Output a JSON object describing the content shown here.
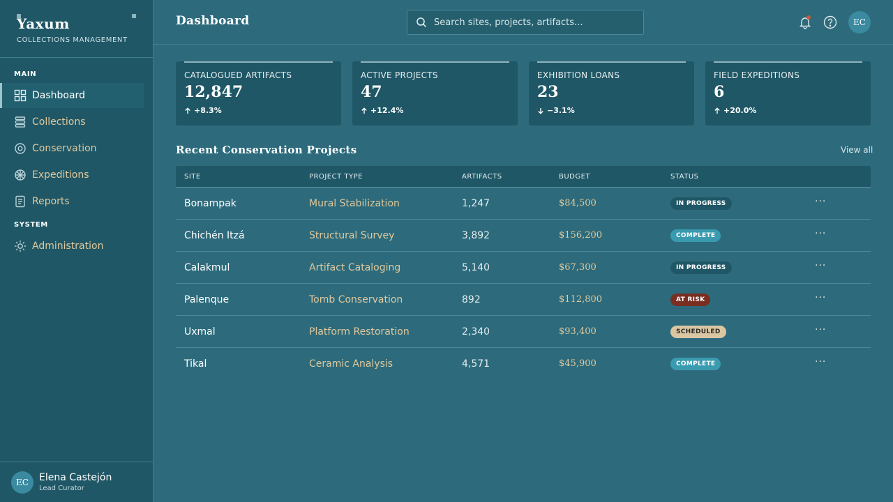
{
  "brand": {
    "name": "Yaxum",
    "subtitle": "COLLECTIONS MANAGEMENT"
  },
  "nav": {
    "main_label": "MAIN",
    "system_label": "SYSTEM",
    "items": [
      {
        "label": "Dashboard",
        "icon": "grid-icon"
      },
      {
        "label": "Collections",
        "icon": "layers-icon"
      },
      {
        "label": "Conservation",
        "icon": "target-icon"
      },
      {
        "label": "Expeditions",
        "icon": "compass-icon"
      },
      {
        "label": "Reports",
        "icon": "document-icon"
      }
    ],
    "system_items": [
      {
        "label": "Administration",
        "icon": "sun-gear-icon"
      }
    ]
  },
  "user": {
    "initials": "EC",
    "name": "Elena Castejón",
    "role": "Lead Curator"
  },
  "header": {
    "title": "Dashboard",
    "search_placeholder": "Search sites, projects, artifacts...",
    "avatar_initials": "EC"
  },
  "stats": [
    {
      "label": "CATALOGUED ARTIFACTS",
      "value": "12,847",
      "trend": "+8.3%",
      "direction": "up"
    },
    {
      "label": "ACTIVE PROJECTS",
      "value": "47",
      "trend": "+12.4%",
      "direction": "up"
    },
    {
      "label": "EXHIBITION LOANS",
      "value": "23",
      "trend": "−3.1%",
      "direction": "down"
    },
    {
      "label": "FIELD EXPEDITIONS",
      "value": "6",
      "trend": "+20.0%",
      "direction": "up"
    }
  ],
  "projects": {
    "title": "Recent Conservation Projects",
    "view_all": "View all",
    "columns": [
      "SITE",
      "PROJECT TYPE",
      "ARTIFACTS",
      "BUDGET",
      "STATUS"
    ],
    "rows": [
      {
        "site": "Bonampak",
        "type": "Mural Stabilization",
        "artifacts": "1,247",
        "budget": "$84,500",
        "status": "IN PROGRESS"
      },
      {
        "site": "Chichén Itzá",
        "type": "Structural Survey",
        "artifacts": "3,892",
        "budget": "$156,200",
        "status": "COMPLETE"
      },
      {
        "site": "Calakmul",
        "type": "Artifact Cataloging",
        "artifacts": "5,140",
        "budget": "$67,300",
        "status": "IN PROGRESS"
      },
      {
        "site": "Palenque",
        "type": "Tomb Conservation",
        "artifacts": "892",
        "budget": "$112,800",
        "status": "AT RISK"
      },
      {
        "site": "Uxmal",
        "type": "Platform Restoration",
        "artifacts": "2,340",
        "budget": "$93,400",
        "status": "SCHEDULED"
      },
      {
        "site": "Tikal",
        "type": "Ceramic Analysis",
        "artifacts": "4,571",
        "budget": "$45,900",
        "status": "COMPLETE"
      }
    ],
    "more_label": "···"
  },
  "colors": {
    "background": "#2d6b7c",
    "sidebar": "#1f5766",
    "accent_gold": "#e0c89c",
    "status_complete": "#3a9bb0",
    "status_risk": "#7a2e22",
    "status_scheduled": "#dac7a2"
  }
}
